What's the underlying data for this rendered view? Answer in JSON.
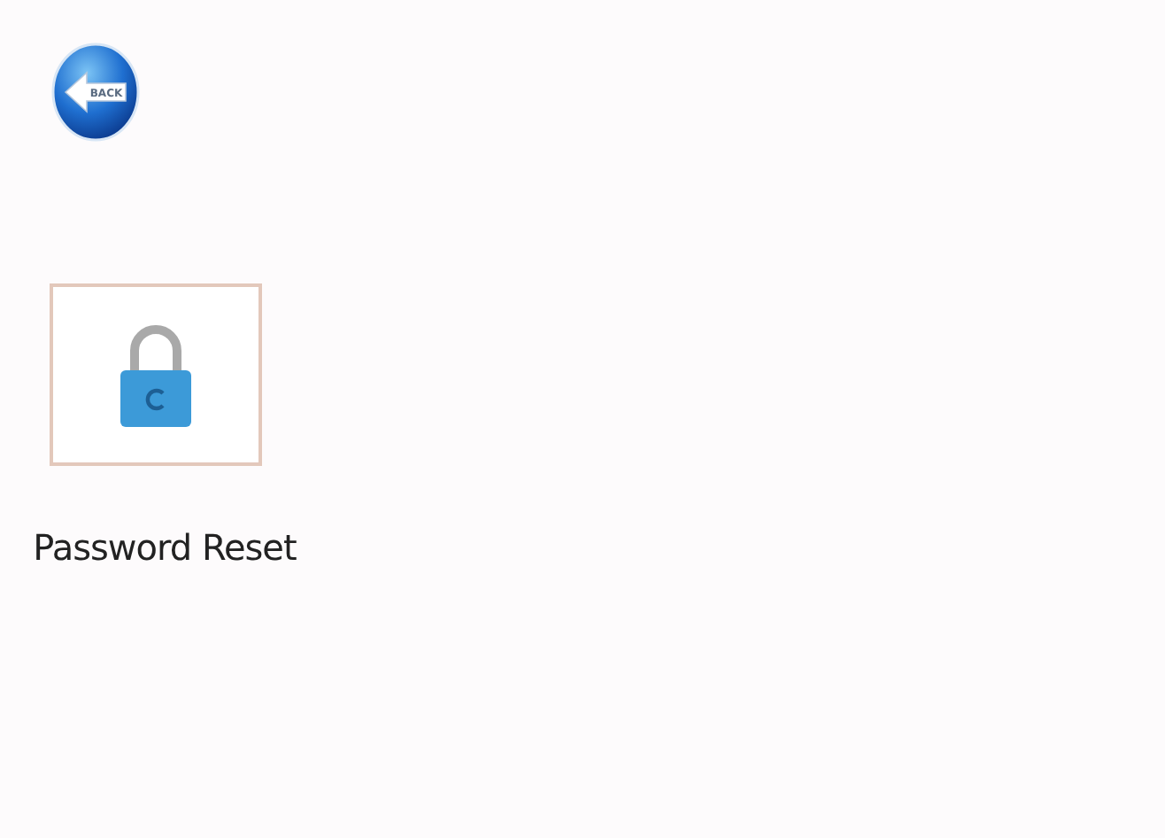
{
  "back_button": {
    "label": "BACK"
  },
  "tiles": [
    {
      "label": "Password Reset"
    }
  ]
}
